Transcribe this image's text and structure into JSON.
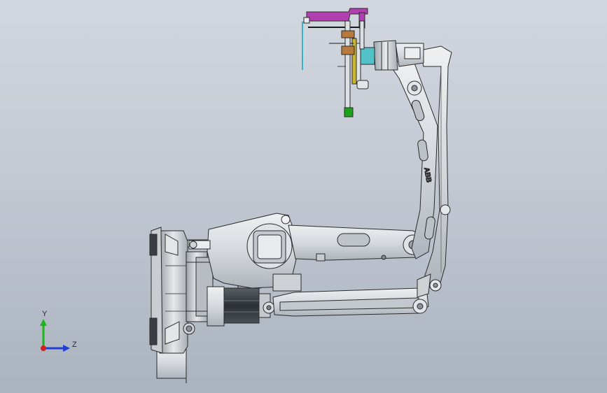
{
  "viewport": {
    "background_top": "#d2d7df",
    "background_bottom": "#aab3bf"
  },
  "model": {
    "brand_label": "ABB",
    "body_color": "#d9dde2",
    "edge_color": "#2b2b2b",
    "bracket_color": "#b03fb0",
    "cable_color": "#35b3c9",
    "flange_color": "#52c2c8",
    "marker_color": "#1aa31a",
    "gear_color": "#b77a3c",
    "rail_color": "#c9b630"
  },
  "triad": {
    "y_label": "Y",
    "z_label": "Z",
    "y_color": "#1db51d",
    "z_color": "#1f3fd6",
    "origin_color": "#d21f1f"
  }
}
